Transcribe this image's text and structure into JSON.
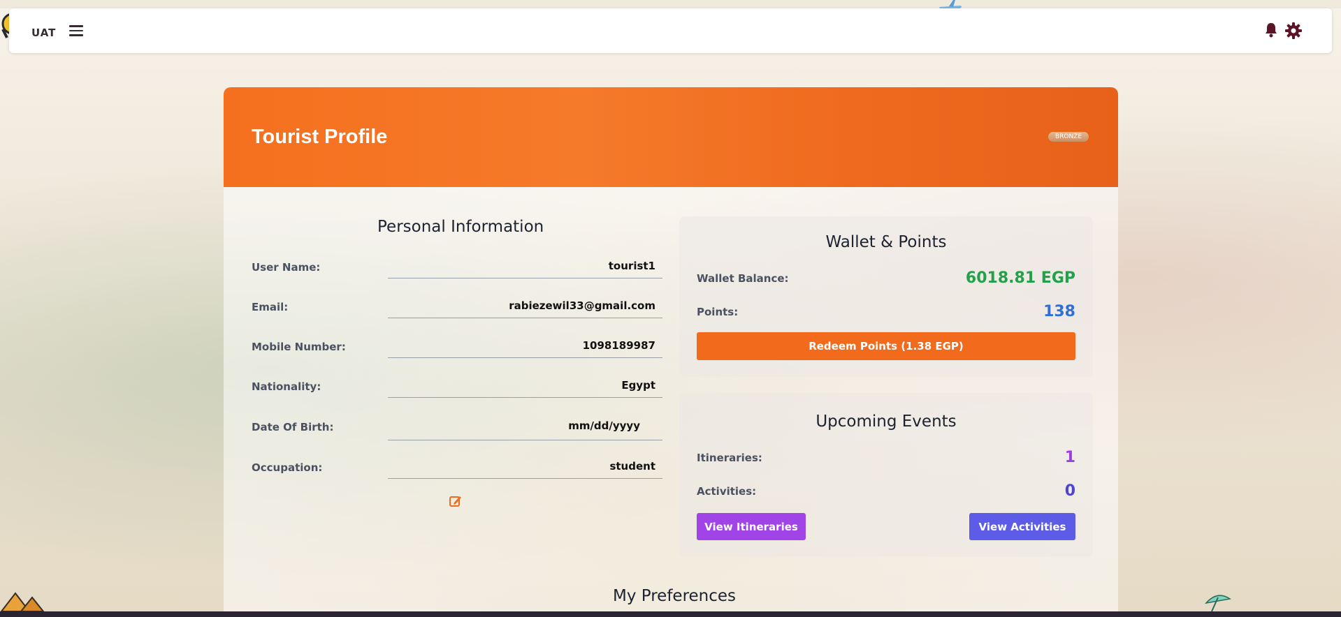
{
  "navbar": {
    "brand": "UAT",
    "icons": [
      "menu-icon",
      "bell-icon",
      "gear-icon"
    ]
  },
  "profile": {
    "title": "Tourist Profile",
    "tier_badge": "BRONZE"
  },
  "personal_info": {
    "title": "Personal Information",
    "fields": [
      {
        "label": "User Name:",
        "value": "tourist1"
      },
      {
        "label": "Email:",
        "value": "rabiezewil33@gmail.com"
      },
      {
        "label": "Mobile Number:",
        "value": "1098189987"
      },
      {
        "label": "Nationality:",
        "value": "Egypt"
      },
      {
        "label": "Date Of Birth:",
        "value": "mm/dd/yyyy"
      },
      {
        "label": "Occupation:",
        "value": "student"
      }
    ]
  },
  "wallet": {
    "title": "Wallet & Points",
    "balance_label": "Wallet Balance:",
    "balance_value": "6018.81 EGP",
    "points_label": "Points:",
    "points_value": "138",
    "redeem_button": "Redeem Points (1.38 EGP)"
  },
  "events": {
    "title": "Upcoming Events",
    "itineraries_label": "Itineraries:",
    "itineraries_value": "1",
    "activities_label": "Activities:",
    "activities_value": "0",
    "view_itineraries_button": "View Itineraries",
    "view_activities_button": "View Activities"
  },
  "preferences": {
    "title": "My Preferences"
  },
  "colors": {
    "header_orange": "#f5701e",
    "balance_green": "#22a14a",
    "points_blue": "#2f6fd8",
    "itineraries_purple": "#9b3fe0",
    "activities_indigo": "#4b45d6"
  }
}
